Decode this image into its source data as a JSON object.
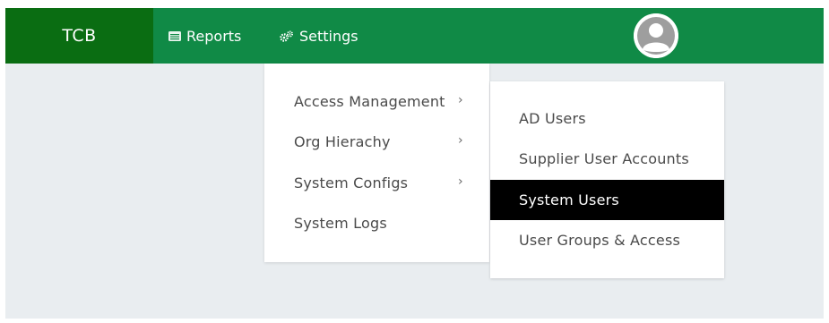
{
  "navbar": {
    "brand": "TCB",
    "reports_label": "Reports",
    "settings_label": "Settings",
    "reports_icon": "list-icon",
    "settings_icon": "gears-icon",
    "avatar_icon": "user-avatar-icon",
    "colors": {
      "bar": "#108a46",
      "brand_bg": "#0a6d12"
    }
  },
  "settings_menu": {
    "items": [
      {
        "label": "Access Management",
        "has_submenu": true
      },
      {
        "label": "Org Hierachy",
        "has_submenu": true
      },
      {
        "label": "System Configs",
        "has_submenu": true
      },
      {
        "label": "System Logs",
        "has_submenu": false
      }
    ]
  },
  "access_submenu": {
    "items": [
      {
        "label": "AD Users"
      },
      {
        "label": "Supplier User Accounts"
      },
      {
        "label": "System Users",
        "active": true
      },
      {
        "label": "User Groups & Access"
      }
    ]
  }
}
